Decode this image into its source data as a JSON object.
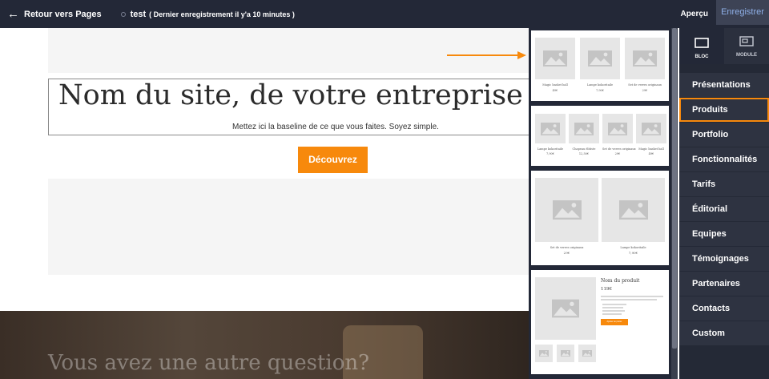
{
  "topbar": {
    "back_label": "Retour vers Pages",
    "doc_name": "test",
    "doc_status": "( Dernier enregistrement il y'a 10 minutes )",
    "preview_label": "Aperçu",
    "save_label": "Enregistrer"
  },
  "canvas": {
    "site_title": "Nom du site, de votre entreprise ou votre",
    "baseline": "Mettez ici la baseline de ce que vous faites. Soyez simple.",
    "cta_label": "Découvrez",
    "question": "Vous avez une autre question?"
  },
  "thumbnails": {
    "t1": {
      "items": [
        {
          "name": "Magic basket ball",
          "price": "49€"
        },
        {
          "name": "Lampe kokoritaile",
          "price": "7,90€"
        },
        {
          "name": "Set de verres originaux",
          "price": "29€"
        }
      ]
    },
    "t2": {
      "items": [
        {
          "name": "Lampe kokoritaile",
          "price": "7,90€"
        },
        {
          "name": "Chapeau élitiste",
          "price": "12,50€"
        },
        {
          "name": "Set de verres originaux",
          "price": "29€"
        },
        {
          "name": "Magic basket ball",
          "price": "49€"
        }
      ]
    },
    "t3": {
      "items": [
        {
          "name": "Set de verres originaux",
          "price": "29€"
        },
        {
          "name": "Lampe kokoritaile",
          "price": "7,90€"
        }
      ]
    },
    "t4": {
      "title": "Nom du produit",
      "price": "119€",
      "button": "Ajouter au panier"
    }
  },
  "panel": {
    "tab_bloc": "BLOC",
    "tab_module": "MODULE",
    "menu": [
      "Présentations",
      "Produits",
      "Portfolio",
      "Fonctionnalités",
      "Tarifs",
      "Éditorial",
      "Equipes",
      "Témoignages",
      "Partenaires",
      "Contacts",
      "Custom"
    ],
    "selected_index": 1
  },
  "colors": {
    "accent": "#f7890c",
    "topbar": "#232837",
    "panel": "#242936",
    "menu_item": "#2e3341",
    "placeholder": "#f5f5f5"
  },
  "icons": {
    "back": "arrow-left-icon",
    "status": "circle-icon",
    "bloc": "rectangle-icon",
    "module": "module-icon",
    "image": "image-placeholder-icon"
  }
}
